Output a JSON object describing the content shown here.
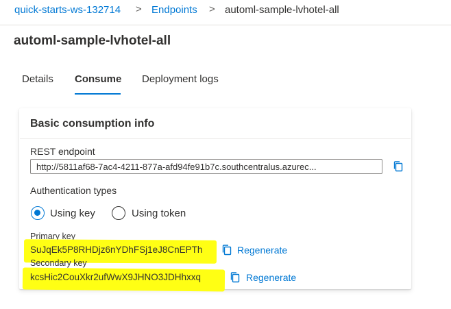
{
  "breadcrumb": {
    "items": [
      "quick-starts-ws-132714",
      "Endpoints",
      "automl-sample-lvhotel-all"
    ],
    "separator": ">"
  },
  "page": {
    "title": "automl-sample-lvhotel-all"
  },
  "tabs": [
    {
      "label": "Details",
      "active": false
    },
    {
      "label": "Consume",
      "active": true
    },
    {
      "label": "Deployment logs",
      "active": false
    }
  ],
  "card": {
    "title": "Basic consumption info",
    "rest": {
      "label": "REST endpoint",
      "value": "http://5811af68-7ac4-4211-877a-afd94fe91b7c.southcentralus.azurec..."
    },
    "auth": {
      "label": "Authentication types",
      "options": [
        {
          "label": "Using key",
          "checked": true
        },
        {
          "label": "Using token",
          "checked": false
        }
      ]
    },
    "primary": {
      "label": "Primary key",
      "value": "SuJqEk5P8RHDjz6nYDhFSj1eJ8CnEPTh",
      "regenerate": "Regenerate"
    },
    "secondary": {
      "label": "Secondary key",
      "value": "kcsHic2CouXkr2ufWwX9JHNO3JDHhxxq",
      "regenerate": "Regenerate"
    }
  },
  "colors": {
    "accent": "#0078d4",
    "highlight": "#ffff14",
    "text": "#323130"
  },
  "icons": [
    "chevron-right-icon",
    "copy-icon",
    "radio-checked-icon",
    "radio-unchecked-icon"
  ]
}
